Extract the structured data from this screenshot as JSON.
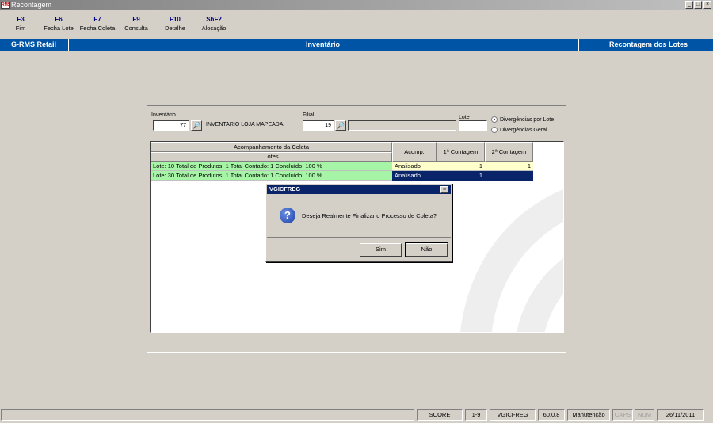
{
  "window": {
    "title": "Recontagem",
    "icon": "app-icon",
    "icon_text": "RMS"
  },
  "toolbar": [
    {
      "key": "F3",
      "label": "Fim"
    },
    {
      "key": "F6",
      "label": "Fecha Lote"
    },
    {
      "key": "F7",
      "label": "Fecha Coleta"
    },
    {
      "key": "F9",
      "label": "Consulta"
    },
    {
      "key": "F10",
      "label": "Detalhe"
    },
    {
      "key": "ShF2",
      "label": "Alocação"
    }
  ],
  "header": {
    "left": "G-RMS Retail",
    "center": "Inventário",
    "right": "Recontagem dos Lotes",
    "color": "#0054a6"
  },
  "filters": {
    "inventario_label": "Inventário",
    "inventario_value": "77",
    "inventario_desc": "INVENTARIO LOJA MAPEADA",
    "filial_label": "Filial",
    "filial_value": "19",
    "filial_desc": "",
    "lote_label": "Lote",
    "lote_value": "",
    "radio_por_lote": "Divergências por Lote",
    "radio_geral": "Divergências Geral"
  },
  "grid": {
    "group_header": "Acompanhamento da Coleta",
    "col_lotes": "Lotes",
    "col_acomp": "Acomp.",
    "col_c1": "1ª Contagem",
    "col_c2": "2ª Contagem",
    "rows": [
      {
        "lote": "Lote: 10 Total de Produtos: 1 Total Contado: 1 Concluído: 100 %",
        "acomp": "Analisado",
        "c1": "1",
        "c2": "1"
      },
      {
        "lote": "Lote: 30 Total de Produtos: 1 Total Contado: 1 Concluído: 100 %",
        "acomp": "Analisado",
        "c1": "1",
        "c2": ""
      }
    ]
  },
  "dialog": {
    "title": "VGICFREG",
    "icon": "question-icon",
    "message": "Deseja Realmente Finalizar o Processo de Coleta?",
    "yes": "Sim",
    "no": "Não"
  },
  "statusbar": {
    "score": "SCORE",
    "range": "1-9",
    "program": "VGICFREG",
    "version": "60.0.8",
    "mode": "Manutenção",
    "caps": "CAPS",
    "num": "NUM",
    "date": "26/11/2011"
  }
}
